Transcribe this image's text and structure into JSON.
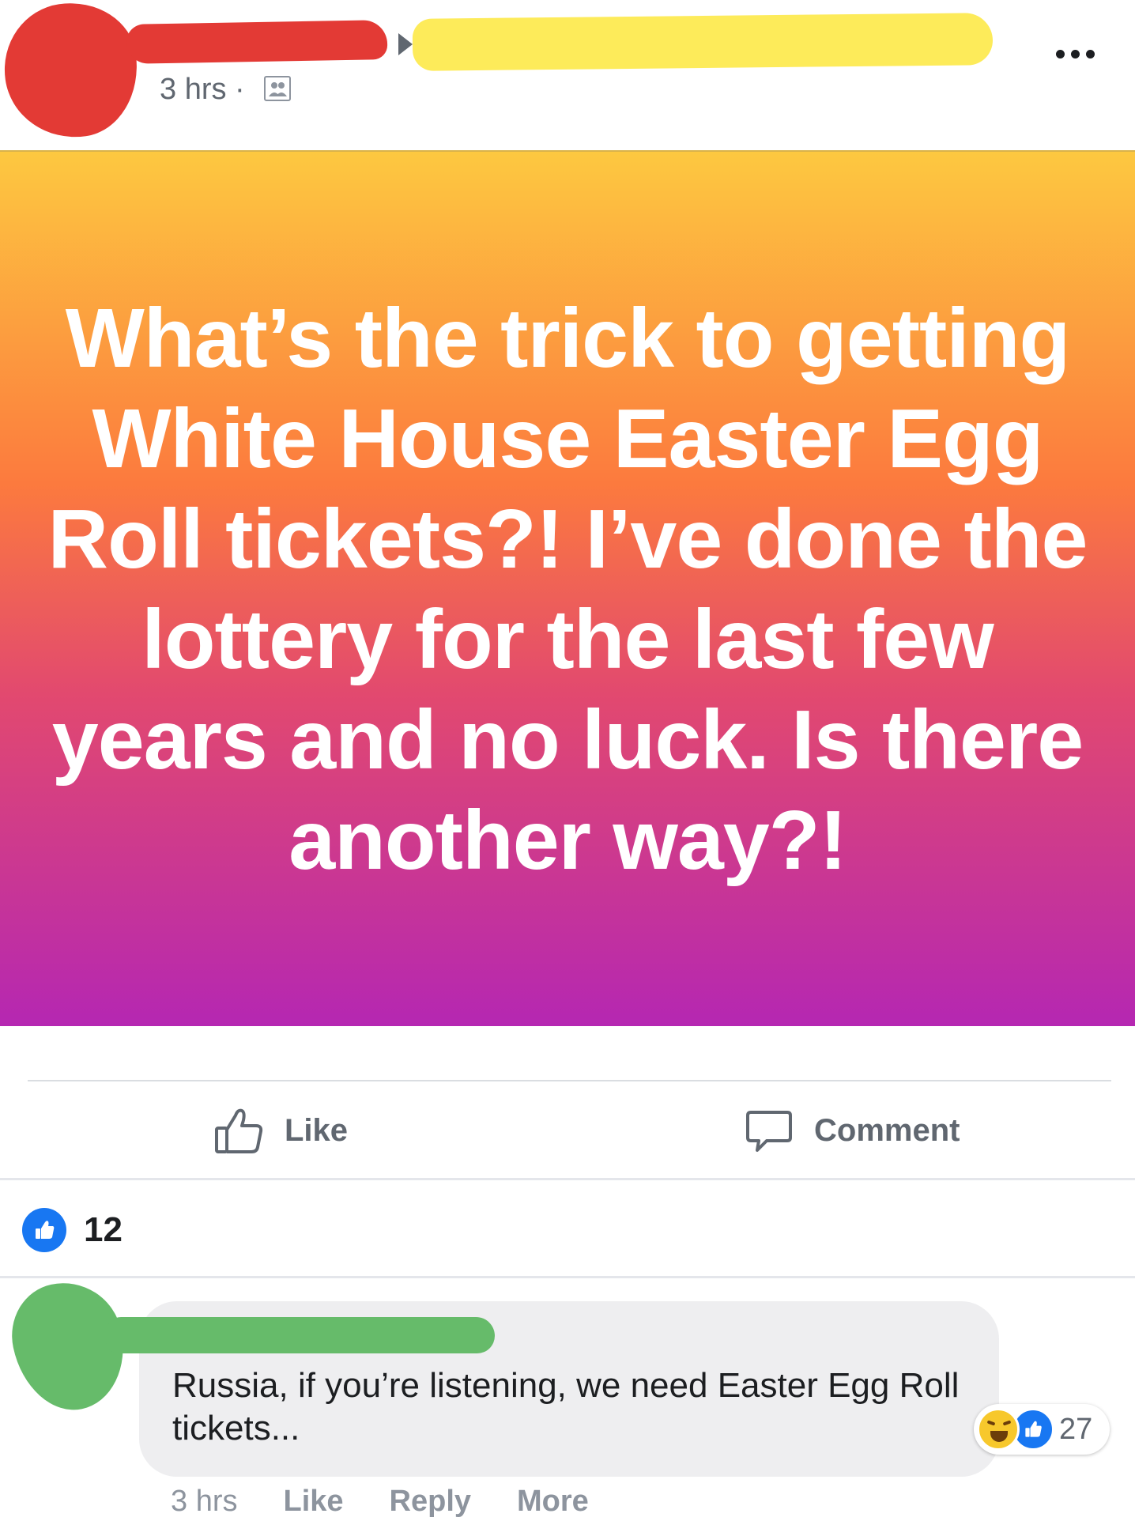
{
  "header": {
    "timestamp": "3 hrs ·",
    "audience_icon": "friends-icon",
    "more_icon": "more-dots-icon"
  },
  "post": {
    "text": "What’s the trick to getting White House Easter Egg Roll tickets?! I’ve done the lottery for the last few years and no luck. Is there another way?!",
    "gradient": [
      "#fdc840",
      "#fc7a3e",
      "#e2496f",
      "#b527b2"
    ]
  },
  "actions": {
    "like_label": "Like",
    "comment_label": "Comment"
  },
  "reactions": {
    "count": "12"
  },
  "comment": {
    "text": "Russia, if you’re listening, we need Easter Egg Roll tickets...",
    "reaction_count": "27",
    "meta": {
      "time": "3 hrs",
      "like_label": "Like",
      "reply_label": "Reply",
      "more_label": "More"
    }
  },
  "colors": {
    "accent": "#1877f2",
    "redaction_red": "#e33a35",
    "redaction_yellow": "#fdeb5a",
    "redaction_green": "#66bb6a"
  }
}
